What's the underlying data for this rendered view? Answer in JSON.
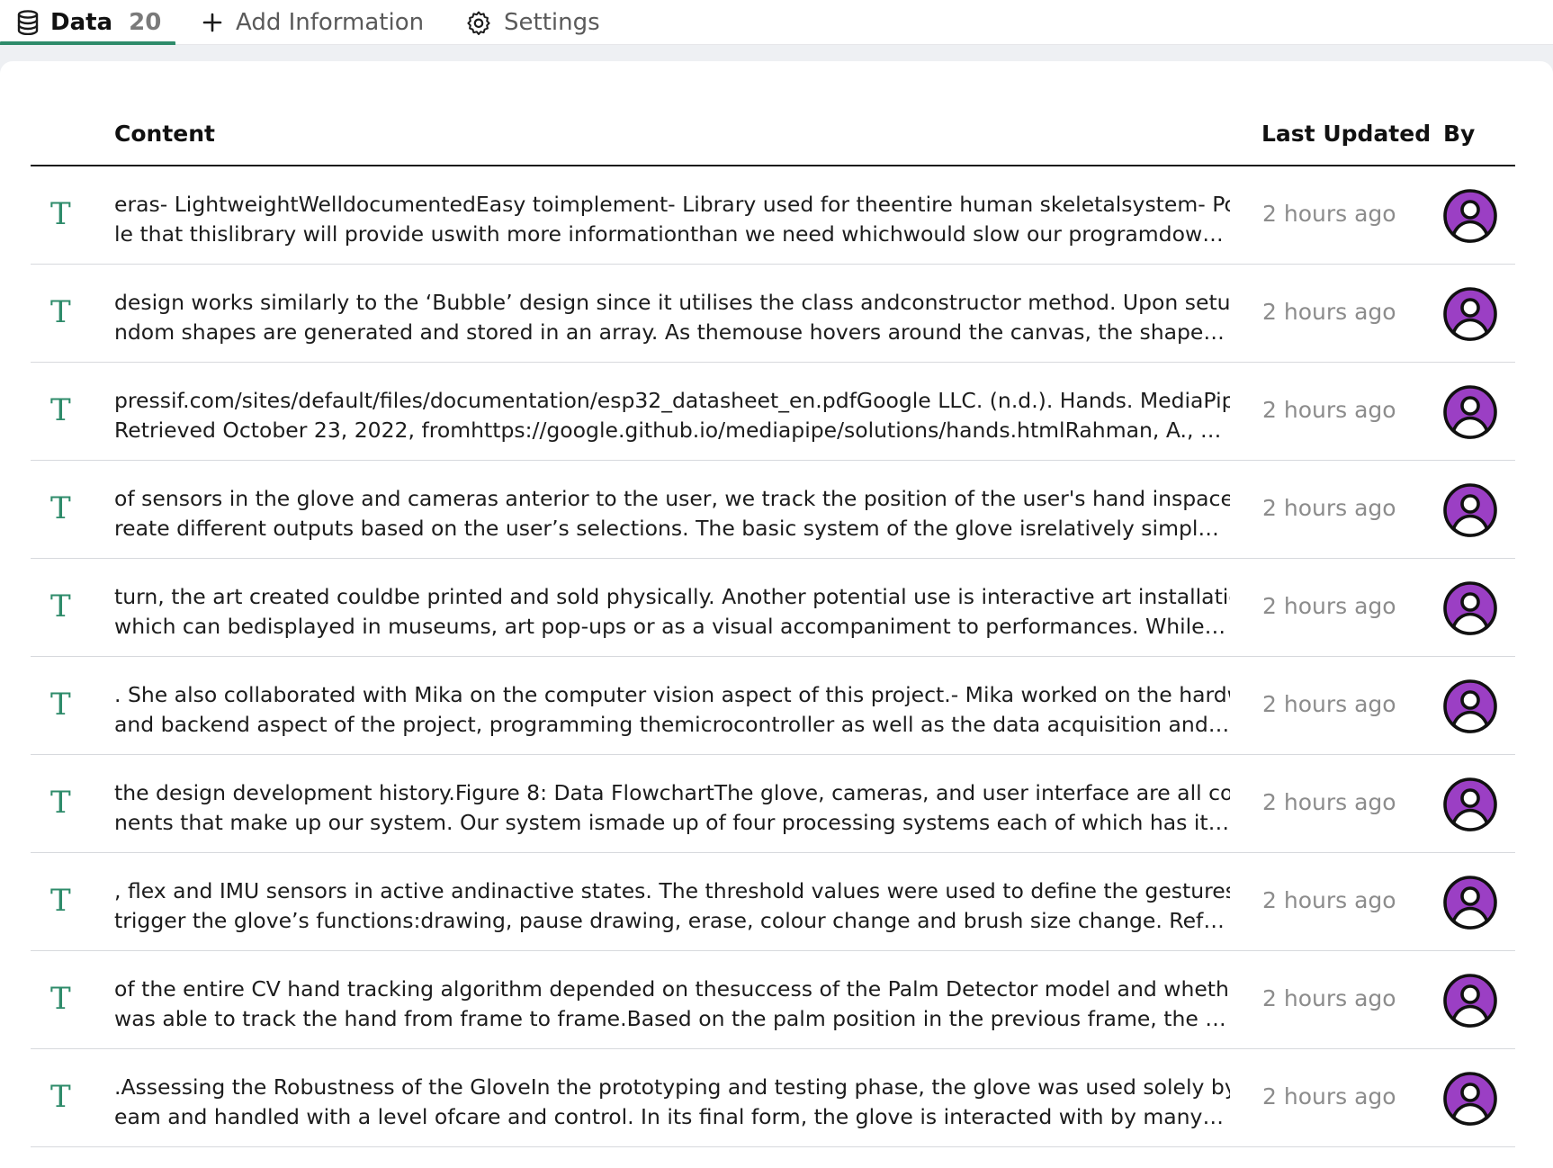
{
  "tabs": {
    "data": {
      "label": "Data",
      "count": "20",
      "icon": "database-icon"
    },
    "add": {
      "label": "Add Information",
      "icon": "plus-icon"
    },
    "settings": {
      "label": "Settings",
      "icon": "gear-icon"
    }
  },
  "table": {
    "headers": {
      "content": "Content",
      "last_updated": "Last Updated",
      "by": "By"
    },
    "rows": [
      {
        "type": "T",
        "line1": "eras- LightweightWelldocumentedEasy toimplement- Library used for theentire human skeletalsystem- Possib",
        "line2": "le that thislibrary will provide uswith more informationthan we need whichwould slow our programdown unnecessarily",
        "updated": "2 hours ago"
      },
      {
        "type": "T",
        "line1": "design works similarly to the ‘Bubble’ design since it utilises the class andconstructor method. Upon setup, ra",
        "line2": "ndom shapes are generated and stored in an array. As themouse hovers around the canvas, the shapes will change",
        "updated": "2 hours ago"
      },
      {
        "type": "T",
        "line1": "pressif.com/sites/default/files/documentation/esp32_datasheet_en.pdfGoogle LLC. (n.d.). Hands. MediaPipe.",
        "line2": "Retrieved October 23, 2022, fromhttps://google.github.io/mediapipe/solutions/hands.htmlRahman, A., & Al-Jumaily",
        "updated": "2 hours ago"
      },
      {
        "type": "T",
        "line1": "of sensors in the glove and cameras anterior to the user, we track the position of the user's hand inspace and c",
        "line2": "reate different outputs based on the user’s selections. The basic system of the glove isrelatively simple and intuitive",
        "updated": "2 hours ago"
      },
      {
        "type": "T",
        "line1": "turn, the art created couldbe printed and sold physically. Another potential use is interactive art installations,",
        "line2": "which can bedisplayed in museums, art pop-ups or as a visual accompaniment to performances. While the design",
        "updated": "2 hours ago"
      },
      {
        "type": "T",
        "line1": ". She also collaborated with Mika on the computer vision aspect of this project.- Mika worked on the hardware",
        "line2": "and backend aspect of the project, programming themicrocontroller as well as the data acquisition and storage",
        "updated": "2 hours ago"
      },
      {
        "type": "T",
        "line1": "the design development history.Figure 8: Data FlowchartThe glove, cameras, and user interface are all compo",
        "line2": "nents that make up our system. Our system ismade up of four processing systems each of which has its own role",
        "updated": "2 hours ago"
      },
      {
        "type": "T",
        "line1": ", flex and IMU sensors in active andinactive states. The threshold values were used to define the gestures that",
        "line2": "trigger the glove’s functions:drawing, pause drawing, erase, colour change and brush size change. Refer to Appendix",
        "updated": "2 hours ago"
      },
      {
        "type": "T",
        "line1": "of the entire CV hand tracking algorithm depended on thesuccess of the Palm Detector model and whether it",
        "line2": "was able to track the hand from frame to frame.Based on the palm position in the previous frame, the palm region",
        "updated": "2 hours ago"
      },
      {
        "type": "T",
        "line1": ".Assessing the Robustness of the GloveIn the prototyping and testing phase, the glove was used solely by the t",
        "line2": "eam and handled with a level ofcare and control. In its final form, the glove is interacted with by many users, so",
        "updated": "2 hours ago"
      }
    ]
  },
  "colors": {
    "accent": "#2e8b6a",
    "avatar": "#9b3fc4",
    "muted": "#8c8c8c"
  }
}
